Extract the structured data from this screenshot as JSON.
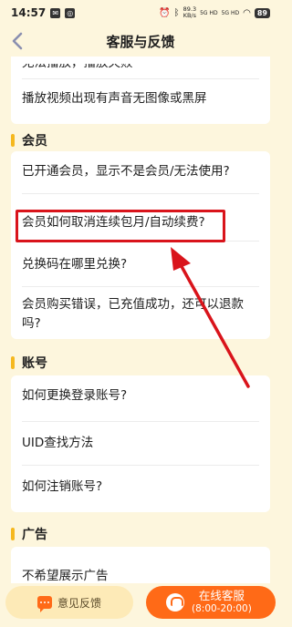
{
  "status_bar": {
    "time": "14:57",
    "speed_value": "89.3",
    "speed_unit": "KB/s",
    "signal1": "5G HD",
    "signal2": "5G HD",
    "battery": "89"
  },
  "header": {
    "title": "客服与反馈"
  },
  "sections": {
    "top": {
      "items": [
        "无法播放，播放失败",
        "播放视频出现有声音无图像或黑屏"
      ]
    },
    "member": {
      "title": "会员",
      "items": [
        "已开通会员，显示不是会员/无法使用?",
        "会员如何取消连续包月/自动续费?",
        "兑换码在哪里兑换?",
        "会员购买错误，已充值成功，还可以退款吗?"
      ]
    },
    "account": {
      "title": "账号",
      "items": [
        "如何更换登录账号?",
        "UID查找方法",
        "如何注销账号?"
      ]
    },
    "ads": {
      "title": "广告",
      "items": [
        "不希望展示广告"
      ]
    }
  },
  "footer": {
    "feedback_label": "意见反馈",
    "online_label": "在线客服",
    "online_hours": "(8:00-20:00)"
  },
  "colors": {
    "accent": "#ff6a17",
    "section_bar": "#f5b81f",
    "annotation": "#d9141b",
    "background": "#fdf6dd"
  }
}
